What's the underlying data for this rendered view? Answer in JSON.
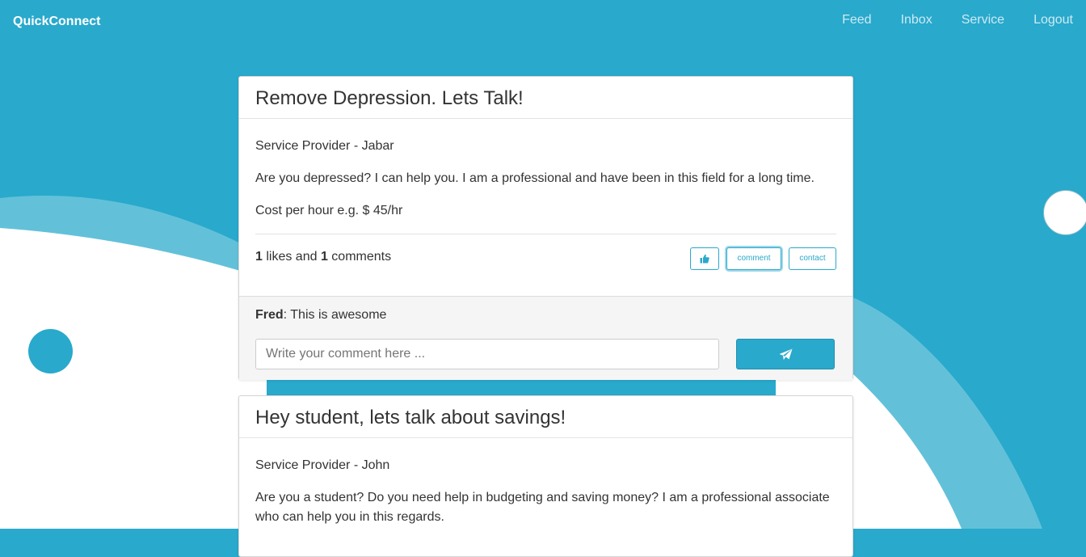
{
  "app": {
    "brand": "QuickConnect"
  },
  "nav": {
    "items": [
      "Feed",
      "Inbox",
      "Service",
      "Logout"
    ]
  },
  "colors": {
    "primary": "#29a9cc",
    "light_wave": "#62c1d9",
    "white": "#ffffff"
  },
  "posts": [
    {
      "title": "Remove Depression. Lets Talk!",
      "provider": "Service Provider - Jabar",
      "description": "Are you depressed? I can help you. I am a professional and have been in this field for a long time.",
      "cost": "Cost per hour e.g. $ 45/hr",
      "likes": "1",
      "likes_label": " likes and ",
      "comments": "1",
      "comments_label": " comments",
      "buttons": {
        "like_icon": "thumbs-up-icon",
        "comment": "comment",
        "contact": "contact"
      },
      "comment_list": [
        {
          "author": "Fred",
          "text": ": This is awesome"
        }
      ],
      "comment_input": {
        "placeholder": "Write your comment here ...",
        "send_icon": "paper-plane-icon"
      }
    },
    {
      "title": "Hey student, lets talk about savings!",
      "provider": "Service Provider - John",
      "description": "Are you a student? Do you need help in budgeting and saving money? I am a professional associate who can help you in this regards."
    }
  ]
}
